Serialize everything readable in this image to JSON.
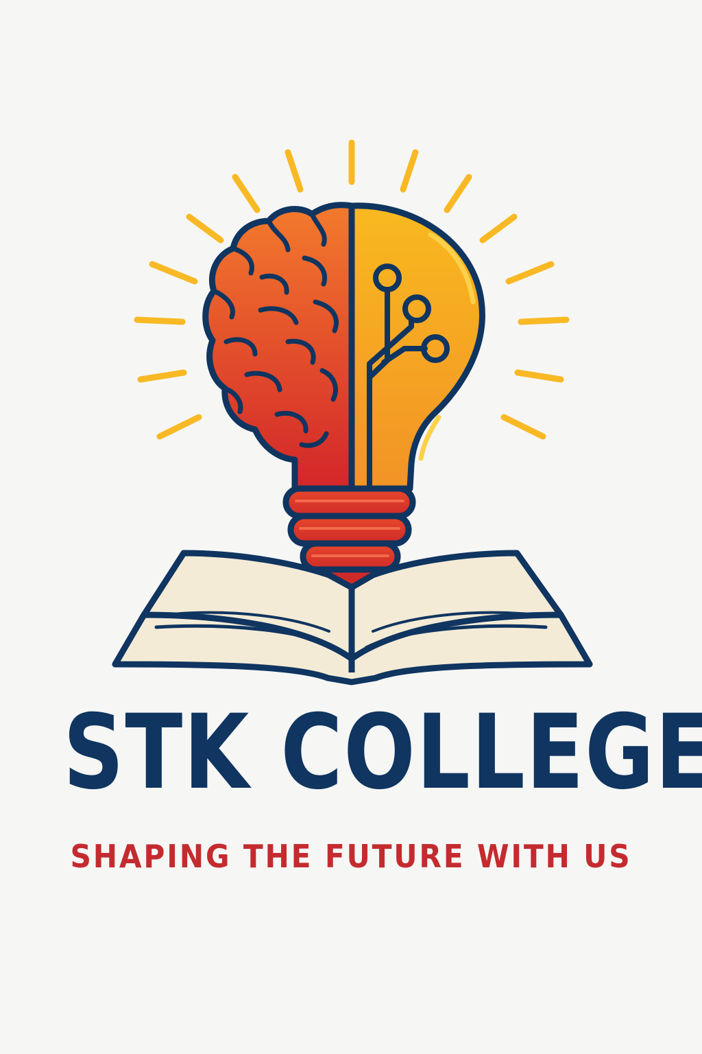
{
  "logo": {
    "name": "STK COLLEGE",
    "tagline": "SHAPING THE FUTURE WITH US"
  },
  "colors": {
    "navy": "#0f3560",
    "red": "#c42b2f",
    "orange": "#f0622a",
    "yellow": "#f7b21e",
    "ray": "#f8b925",
    "page_cream": "#f4ebd6",
    "background": "#f6f6f5"
  },
  "icons": [
    "brain-icon",
    "lightbulb-icon",
    "circuit-icon",
    "open-book-icon",
    "light-rays-icon"
  ]
}
